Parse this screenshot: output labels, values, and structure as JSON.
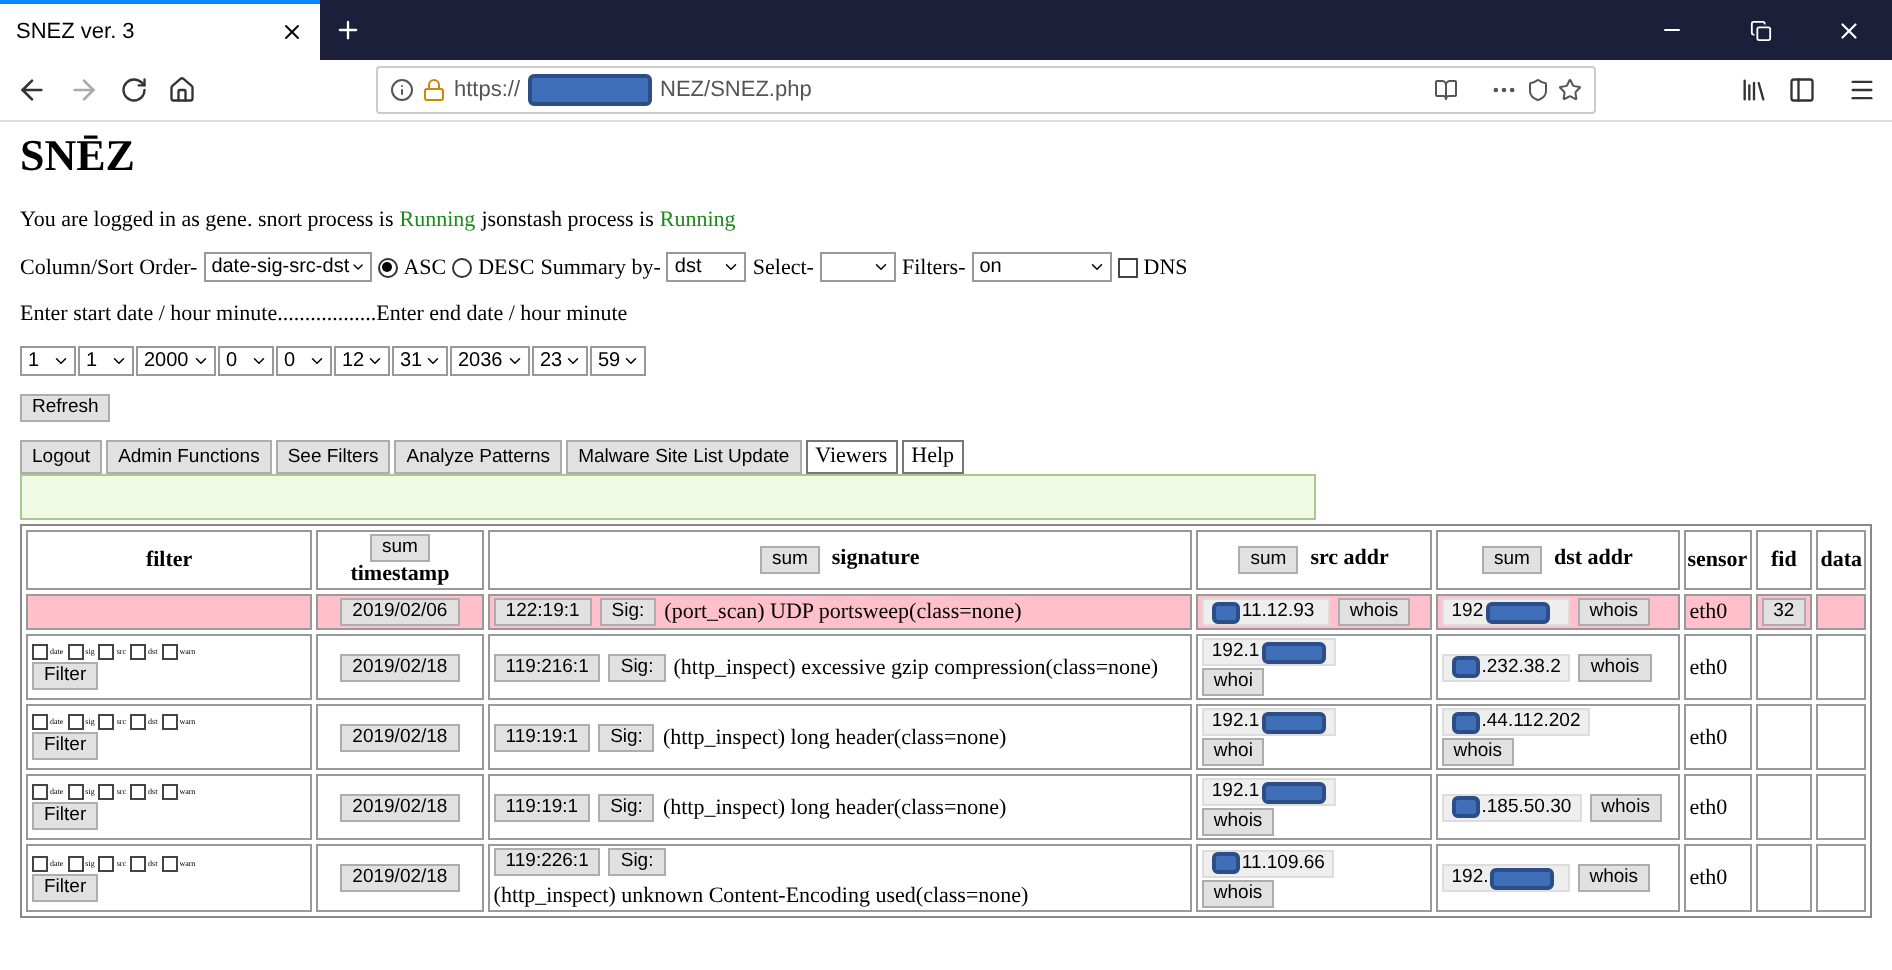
{
  "browser": {
    "tab_title": "SNEZ ver. 3",
    "url_prefix": "https://",
    "url_redacted": true,
    "url_suffix": "NEZ/SNEZ.php"
  },
  "page": {
    "title": "SNĒZ",
    "status": [
      {
        "text": "You are logged in as gene. snort process is",
        "kind": "plain"
      },
      {
        "text": "Running",
        "kind": "ok"
      },
      {
        "text": "jsonstash process is",
        "kind": "plain"
      },
      {
        "text": "Running",
        "kind": "ok"
      }
    ],
    "sort": {
      "label": "Column/Sort Order-",
      "value": "date-sig-src-dst"
    },
    "order_options": [
      {
        "label": "ASC",
        "selected": true
      },
      {
        "label": "DESC",
        "selected": false
      }
    ],
    "summary": {
      "label": "Summary by-",
      "value": "dst"
    },
    "select": {
      "label": "Select-"
    },
    "filters": {
      "label": "Filters-",
      "value": "on"
    },
    "dns": {
      "label": "DNS",
      "checked": false
    },
    "date_prompt": "Enter start date / hour minute..................Enter end date / hour minute",
    "date_selects": [
      "1",
      "1",
      "2000",
      "0",
      "0",
      "12",
      "31",
      "2036",
      "23",
      "59"
    ],
    "refresh": "Refresh",
    "nav_buttons": [
      {
        "label": "Logout",
        "kind": "gray"
      },
      {
        "label": "Admin Functions",
        "kind": "gray"
      },
      {
        "label": "See Filters",
        "kind": "gray"
      },
      {
        "label": "Analyze Patterns",
        "kind": "gray"
      },
      {
        "label": "Malware Site List Update",
        "kind": "gray"
      },
      {
        "label": "Viewers",
        "kind": "white"
      },
      {
        "label": "Help",
        "kind": "white"
      }
    ]
  },
  "table": {
    "columns": [
      {
        "label": "filter",
        "kind": "plain"
      },
      {
        "label": "timestamp",
        "kind": "sum_above",
        "sum": "sum"
      },
      {
        "label": "signature",
        "kind": "sum_left",
        "sum": "sum"
      },
      {
        "label": "src addr",
        "kind": "sum_left",
        "sum": "sum"
      },
      {
        "label": "dst addr",
        "kind": "sum_left",
        "sum": "sum"
      },
      {
        "label": "sensor",
        "kind": "plain"
      },
      {
        "label": "fid",
        "kind": "plain"
      },
      {
        "label": "data",
        "kind": "plain"
      }
    ],
    "rows": [
      {
        "highlighted": true,
        "timestamp": "2019/02/06",
        "sig_id": "122:19:1",
        "sig_button": "Sig:",
        "signature": "(port_scan) UDP portsweep(class=none)",
        "src": {
          "kind": "inline",
          "redacted": true,
          "after": "11.12.93",
          "whois": "whois"
        },
        "dst": {
          "kind": "inline",
          "before": "192",
          "redacted": true,
          "whois": "whois"
        },
        "sensor": "eth0",
        "fid": "32"
      },
      {
        "highlighted": false,
        "filter": {
          "options": [
            {
              "label": "date",
              "checked": false
            },
            {
              "label": "sig",
              "checked": false
            },
            {
              "label": "src",
              "checked": false
            },
            {
              "label": "dst",
              "checked": false
            },
            {
              "label": "warn",
              "checked": false
            }
          ],
          "button": "Filter"
        },
        "timestamp": "2019/02/18",
        "sig_id": "119:216:1",
        "sig_button": "Sig:",
        "signature": "(http_inspect) excessive gzip compression(class=none)",
        "src": {
          "kind": "stacked",
          "before": "192.1",
          "redacted": true,
          "whois": "whoi"
        },
        "dst": {
          "kind": "inline",
          "redacted": true,
          "after": ".232.38.2",
          "whois": "whois"
        },
        "sensor": "eth0"
      },
      {
        "highlighted": false,
        "filter": {
          "options": [
            {
              "label": "date",
              "checked": false
            },
            {
              "label": "sig",
              "checked": false
            },
            {
              "label": "src",
              "checked": false
            },
            {
              "label": "dst",
              "checked": false
            },
            {
              "label": "warn",
              "checked": false
            }
          ],
          "button": "Filter"
        },
        "timestamp": "2019/02/18",
        "sig_id": "119:19:1",
        "sig_button": "Sig:",
        "signature": "(http_inspect) long header(class=none)",
        "src": {
          "kind": "stacked",
          "before": "192.1",
          "redacted": true,
          "whois": "whoi"
        },
        "dst": {
          "kind": "stacked",
          "redacted": true,
          "after": ".44.112.202",
          "whois": "whois"
        },
        "sensor": "eth0"
      },
      {
        "highlighted": false,
        "filter": {
          "options": [
            {
              "label": "date",
              "checked": false
            },
            {
              "label": "sig",
              "checked": false
            },
            {
              "label": "src",
              "checked": false
            },
            {
              "label": "dst",
              "checked": false
            },
            {
              "label": "warn",
              "checked": false
            }
          ],
          "button": "Filter"
        },
        "timestamp": "2019/02/18",
        "sig_id": "119:19:1",
        "sig_button": "Sig:",
        "signature": "(http_inspect) long header(class=none)",
        "src": {
          "kind": "stacked",
          "before": "192.1",
          "redacted": true,
          "whois": "whois"
        },
        "dst": {
          "kind": "inline",
          "redacted": true,
          "after": ".185.50.30",
          "whois": "whois"
        },
        "sensor": "eth0"
      },
      {
        "highlighted": false,
        "filter": {
          "options": [
            {
              "label": "date",
              "checked": false
            },
            {
              "label": "sig",
              "checked": false
            },
            {
              "label": "src",
              "checked": false
            },
            {
              "label": "dst",
              "checked": false
            },
            {
              "label": "warn",
              "checked": false
            }
          ],
          "button": "Filter"
        },
        "timestamp": "2019/02/18",
        "sig_id": "119:226:1",
        "sig_button": "Sig:",
        "signature": "(http_inspect) unknown Content-Encoding used(class=none)",
        "src": {
          "kind": "stacked",
          "redacted": true,
          "after": "11.109.66",
          "whois": "whois"
        },
        "dst": {
          "kind": "inline",
          "before": "192.",
          "redacted": true,
          "whois": "whois"
        },
        "sensor": "eth0"
      }
    ]
  }
}
